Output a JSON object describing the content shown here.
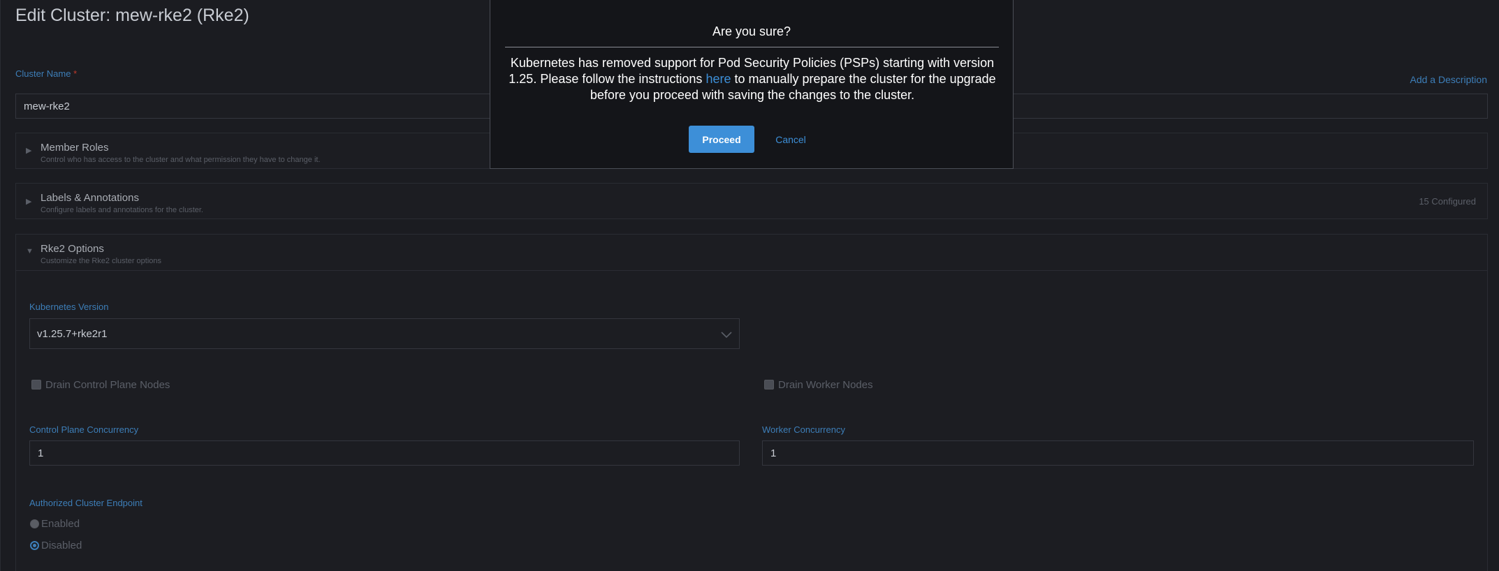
{
  "page": {
    "title": "Edit Cluster: mew-rke2 (Rke2)",
    "cluster_name_label": "Cluster Name",
    "required_mark": "*",
    "cluster_name_value": "mew-rke2",
    "add_description": "Add a Description"
  },
  "sections": {
    "member_roles": {
      "title": "Member Roles",
      "subtitle": "Control who has access to the cluster and what permission they have to change it."
    },
    "labels": {
      "title": "Labels & Annotations",
      "subtitle": "Configure labels and annotations for the cluster.",
      "configured": "15 Configured"
    },
    "rke2": {
      "title": "Rke2 Options",
      "subtitle": "Customize the Rke2 cluster options"
    }
  },
  "rke2_options": {
    "k8s_version_label": "Kubernetes Version",
    "k8s_version_value": "v1.25.7+rke2r1",
    "drain_control_plane": "Drain Control Plane Nodes",
    "drain_worker": "Drain Worker Nodes",
    "cp_concurrency_label": "Control Plane Concurrency",
    "cp_concurrency_value": "1",
    "worker_concurrency_label": "Worker Concurrency",
    "worker_concurrency_value": "1",
    "ace_label": "Authorized Cluster Endpoint",
    "ace_enabled": "Enabled",
    "ace_disabled": "Disabled",
    "ace_selected": "Disabled"
  },
  "modal": {
    "title": "Are you sure?",
    "body_before": "Kubernetes has removed support for Pod Security Policies (PSPs) starting with version 1.25. Please follow the instructions ",
    "link_text": "here",
    "body_after": " to manually prepare the cluster for the upgrade before you proceed with saving the changes to the cluster.",
    "proceed": "Proceed",
    "cancel": "Cancel"
  },
  "colors": {
    "background": "#1b1c21",
    "modal_background": "#141519",
    "accent": "#3d8fd8",
    "label_blue": "#3d7eb8"
  }
}
